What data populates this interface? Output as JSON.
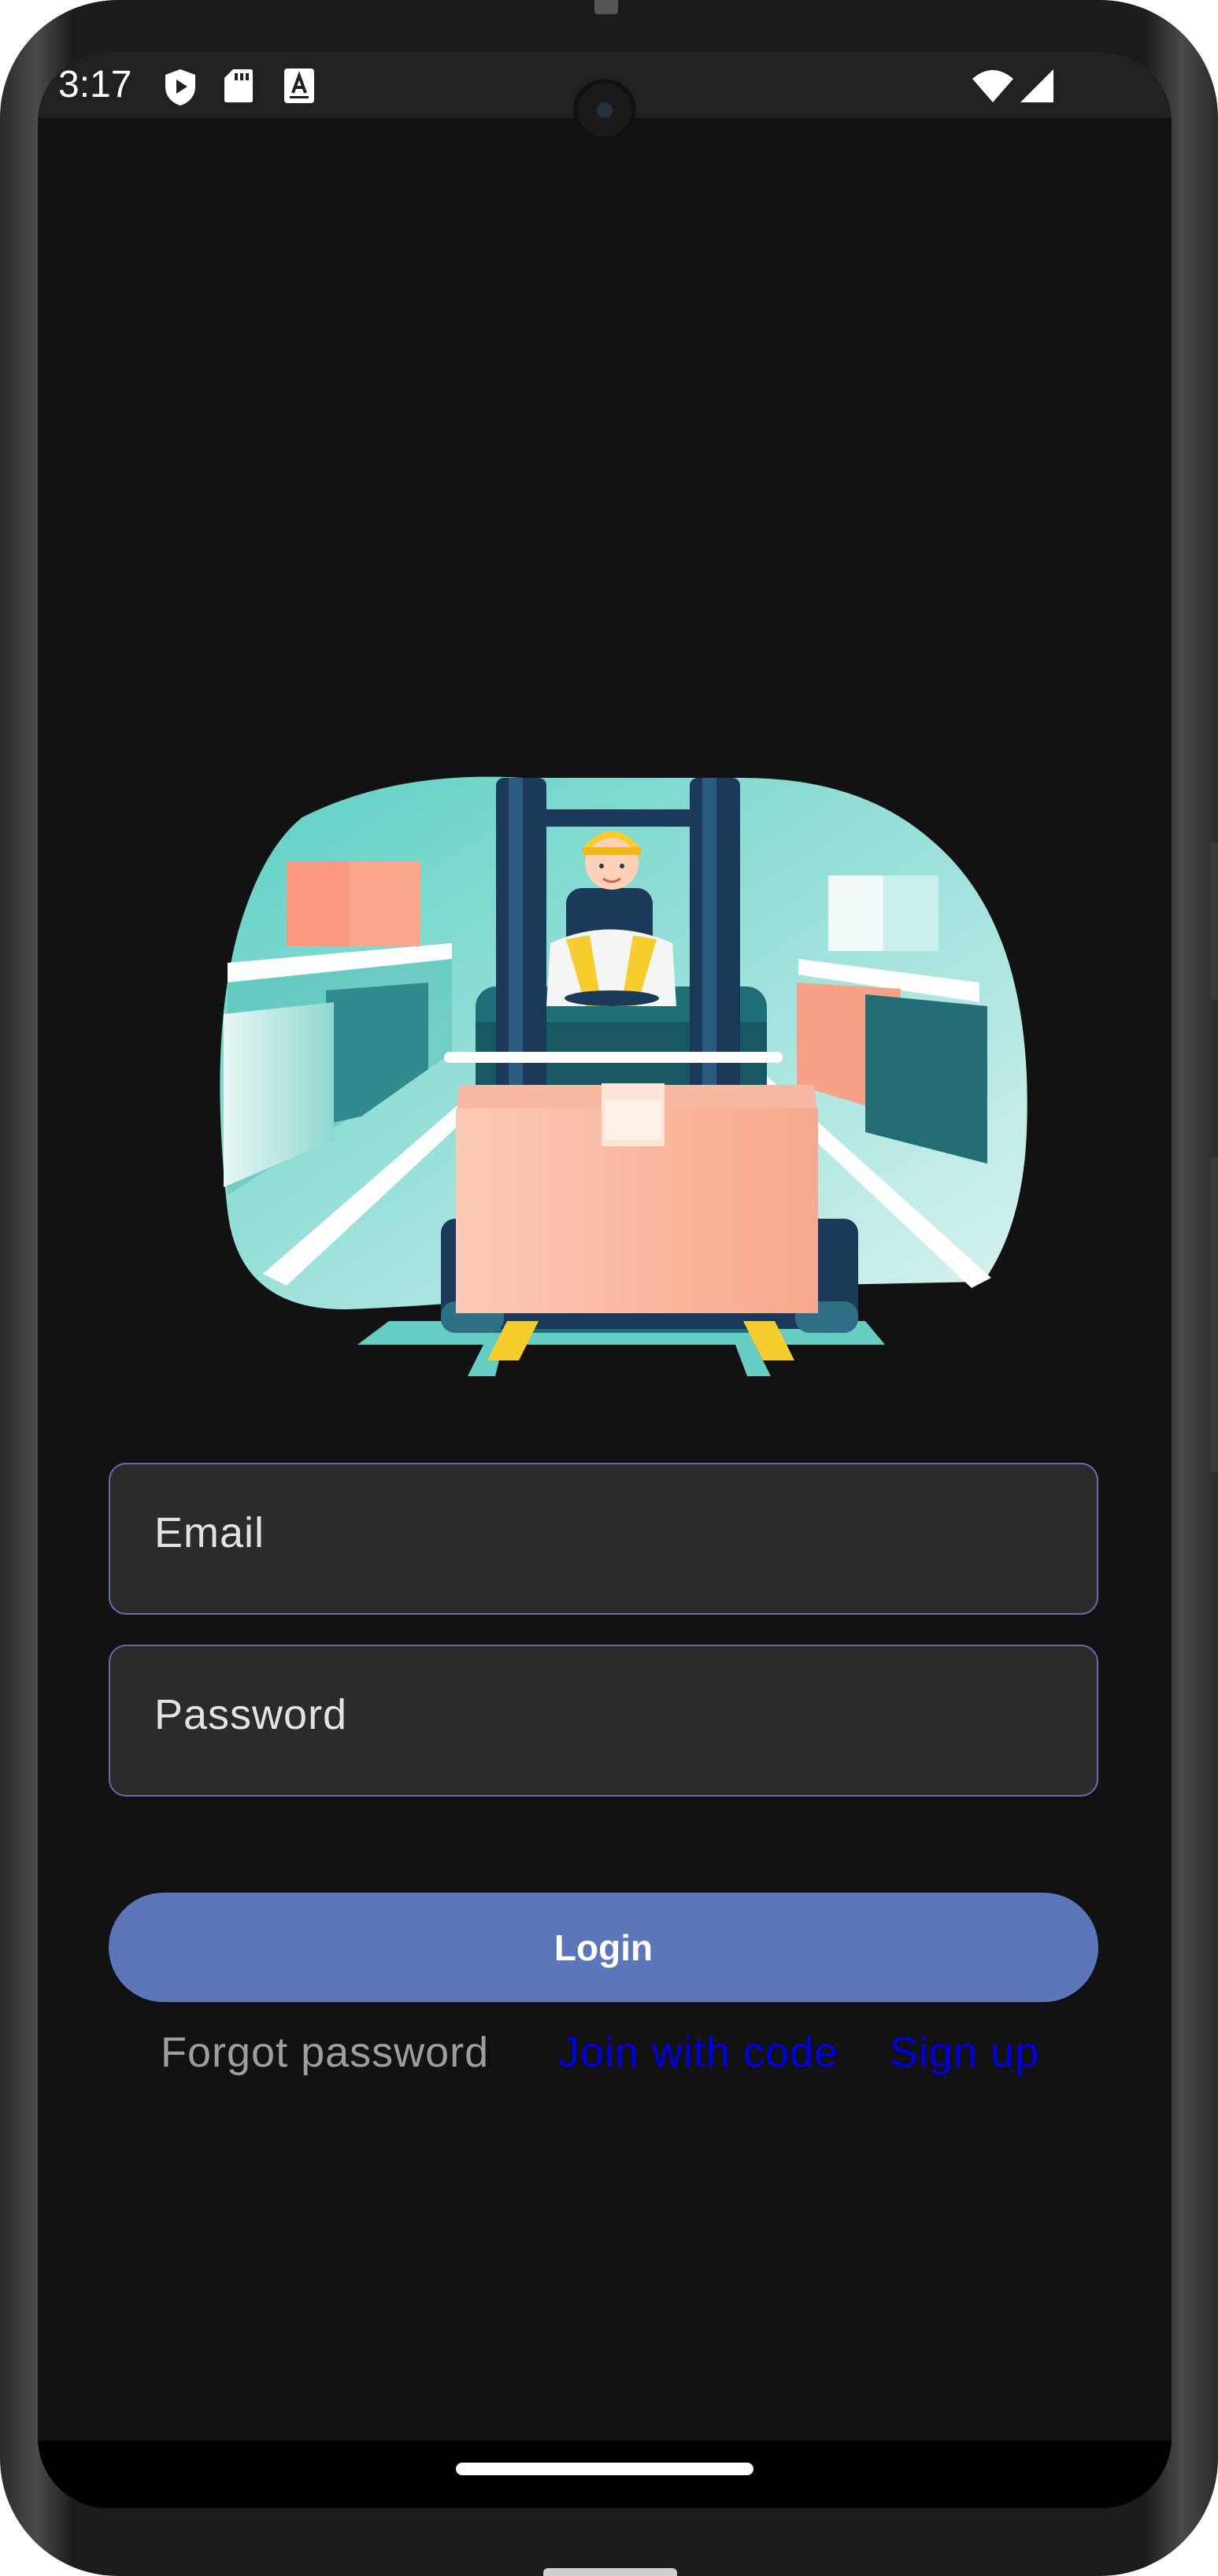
{
  "status_bar": {
    "time": "3:17",
    "left_icons": [
      "shield-play-icon",
      "sd-card-icon",
      "font-a-icon"
    ],
    "right_icons": [
      "wifi-icon",
      "cellular-signal-icon"
    ]
  },
  "illustration": {
    "icon": "forklift-warehouse-illustration",
    "colors": {
      "teal": "#4fc1b5",
      "dark_teal": "#1f6f78",
      "navy": "#1b3a5a",
      "peach": "#f9ad94",
      "yellow": "#f6cd2a"
    }
  },
  "form": {
    "email_label": "Email",
    "email_value": "",
    "password_label": "Password",
    "password_value": "",
    "login_label": "Login"
  },
  "links": {
    "forgot_password": "Forgot password",
    "join_with_code": "Join with code",
    "sign_up": "Sign up"
  },
  "colors": {
    "background": "#121212",
    "field_background": "#2b2b2c",
    "field_border": "#5f6fa8",
    "primary_button": "#5b77ba",
    "link_color": "#0000e6",
    "muted_text": "#9e9e9e"
  }
}
